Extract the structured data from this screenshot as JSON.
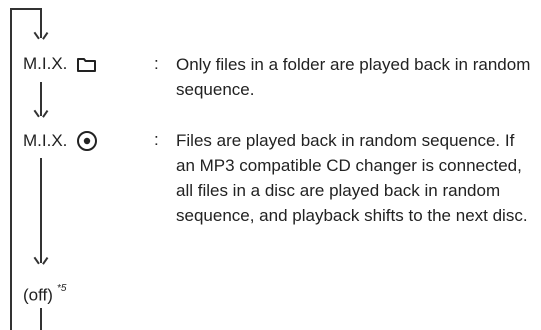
{
  "modes": [
    {
      "label": "M.I.X.",
      "icon": "folder-icon",
      "colon": ":",
      "description": "Only files in a folder are played back in random sequence."
    },
    {
      "label": "M.I.X.",
      "icon": "disc-icon",
      "colon": ":",
      "description": "Files are played back in random sequence. If an MP3 compatible CD changer is connected, all files in a disc are played back in random sequence, and playback shifts to the next disc."
    }
  ],
  "off": {
    "label": "(off)",
    "footnote": "*5"
  }
}
